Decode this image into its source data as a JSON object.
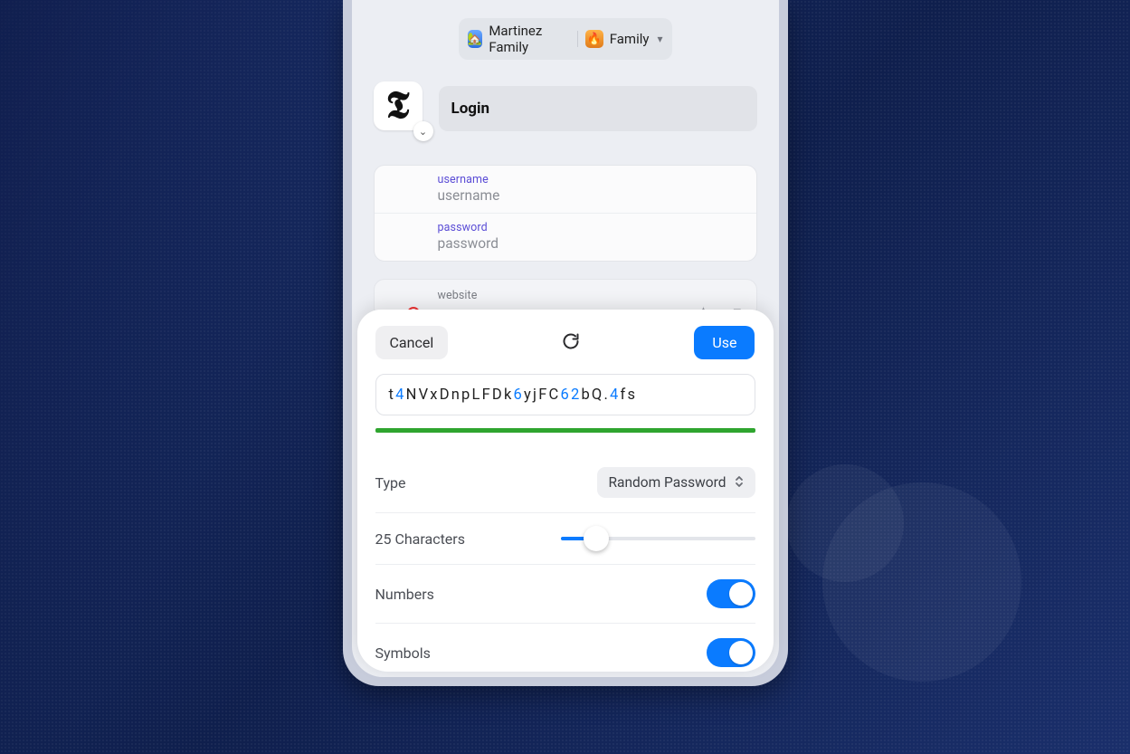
{
  "vaults": {
    "primary": {
      "icon": "🏡",
      "name": "Martinez Family"
    },
    "secondary": {
      "icon": "🔥",
      "name": "Family"
    }
  },
  "item": {
    "title": "Login",
    "site_glyph": "𝕿"
  },
  "fields": {
    "username": {
      "label": "username",
      "placeholder": "username"
    },
    "password": {
      "label": "password",
      "placeholder": "password"
    },
    "website": {
      "label": "website"
    }
  },
  "generator": {
    "cancel": "Cancel",
    "use": "Use",
    "password_chars": [
      {
        "c": "t",
        "k": "l"
      },
      {
        "c": "4",
        "k": "d"
      },
      {
        "c": "N",
        "k": "l"
      },
      {
        "c": "V",
        "k": "l"
      },
      {
        "c": "x",
        "k": "l"
      },
      {
        "c": "D",
        "k": "l"
      },
      {
        "c": "n",
        "k": "l"
      },
      {
        "c": "p",
        "k": "l"
      },
      {
        "c": "L",
        "k": "l"
      },
      {
        "c": "F",
        "k": "l"
      },
      {
        "c": "D",
        "k": "l"
      },
      {
        "c": "k",
        "k": "l"
      },
      {
        "c": "6",
        "k": "d"
      },
      {
        "c": "y",
        "k": "l"
      },
      {
        "c": "j",
        "k": "l"
      },
      {
        "c": "F",
        "k": "l"
      },
      {
        "c": "C",
        "k": "l"
      },
      {
        "c": "6",
        "k": "d"
      },
      {
        "c": "2",
        "k": "d"
      },
      {
        "c": "b",
        "k": "l"
      },
      {
        "c": "Q",
        "k": "l"
      },
      {
        "c": ".",
        "k": "s"
      },
      {
        "c": "4",
        "k": "d"
      },
      {
        "c": "f",
        "k": "l"
      },
      {
        "c": "s",
        "k": "l"
      }
    ],
    "type_label": "Type",
    "type_value": "Random Password",
    "length_label": "25 Characters",
    "length_value": 25,
    "length_min": 8,
    "length_max": 100,
    "numbers_label": "Numbers",
    "numbers_on": true,
    "symbols_label": "Symbols",
    "symbols_on": true,
    "strength_color": "#2fa52f"
  }
}
